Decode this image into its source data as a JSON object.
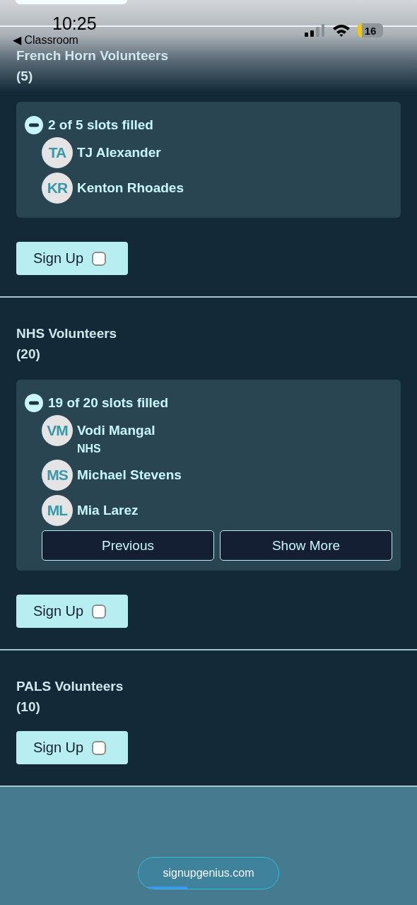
{
  "status_bar": {
    "time": "10:25",
    "back_label": "◀ Classroom",
    "battery": "16"
  },
  "slots": [
    {
      "title": "French Horn Volunteers",
      "count": "(5)",
      "filled": {
        "label": "2 of 5 slots filled",
        "expanded": true,
        "people": [
          {
            "initials": "TA",
            "name": "TJ Alexander"
          },
          {
            "initials": "KR",
            "name": "Kenton Rhoades"
          }
        ]
      },
      "signup": {
        "label": "Sign Up",
        "checked": false
      }
    },
    {
      "title": "NHS Volunteers",
      "count": "(20)",
      "filled": {
        "label": "19 of 20 slots filled",
        "expanded": true,
        "people": [
          {
            "initials": "VM",
            "name": "Vodi Mangal",
            "note": "NHS"
          },
          {
            "initials": "MS",
            "name": "Michael Stevens"
          },
          {
            "initials": "ML",
            "name": "Mia Larez"
          }
        ],
        "pager": [
          "Previous",
          "Show More"
        ]
      },
      "signup": {
        "label": "Sign Up",
        "checked": false
      }
    },
    {
      "title": "PALS Volunteers",
      "count": "(10)",
      "signup": {
        "label": "Sign Up",
        "checked": false
      }
    }
  ],
  "address_bar": {
    "url": "signupgenius.com",
    "level": 0.35
  }
}
